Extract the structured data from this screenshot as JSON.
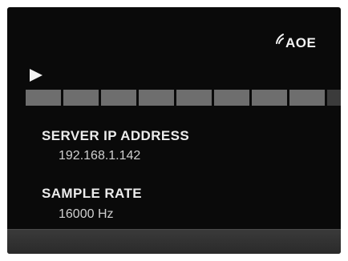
{
  "logo": {
    "text": "AOE",
    "icon": "signal-waves-icon"
  },
  "player": {
    "play_icon": "play-icon",
    "progress": {
      "total_segments": 9,
      "filled_segments": 8
    }
  },
  "server": {
    "label": "SERVER IP ADDRESS",
    "value": "192.168.1.142"
  },
  "sample_rate": {
    "label": "SAMPLE RATE",
    "value": "16000 Hz"
  },
  "colors": {
    "background": "#0a0a0a",
    "text": "#ececec",
    "segment_filled": "#6e6e6e",
    "segment_empty": "#3b3b3b"
  }
}
